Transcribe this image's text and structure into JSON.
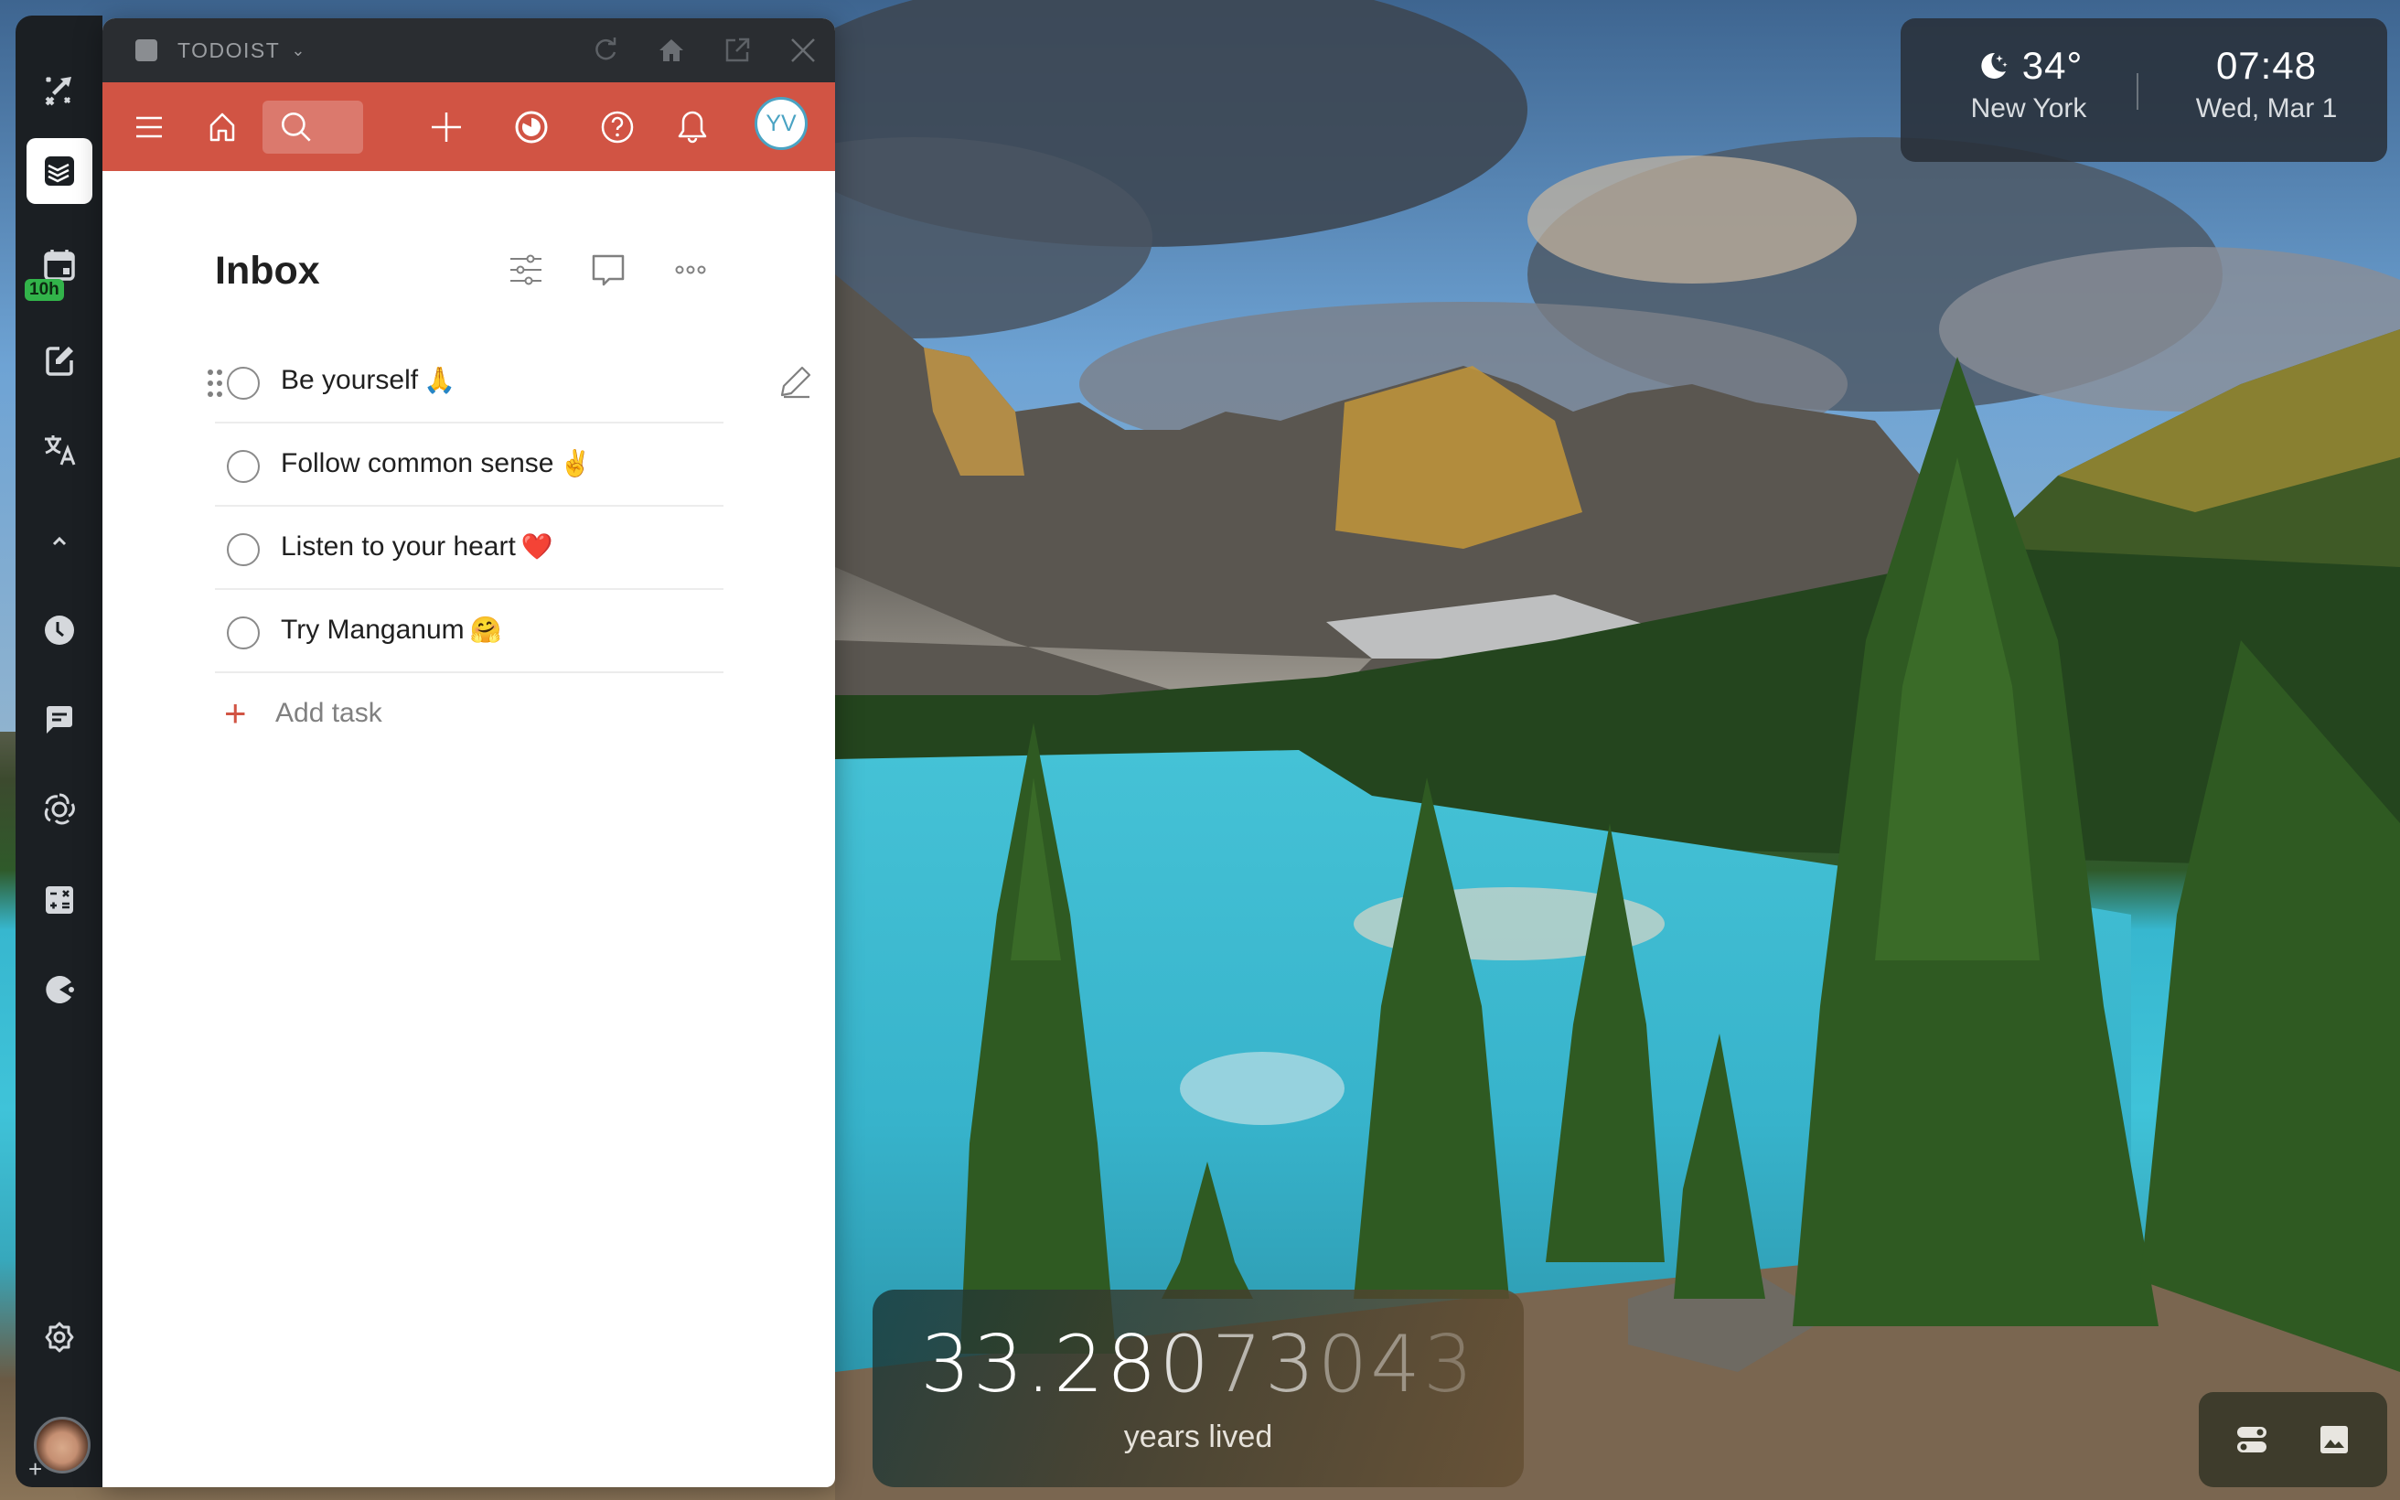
{
  "window": {
    "app_name": "TODOIST",
    "titlebar_actions": [
      "reload",
      "home",
      "open-external",
      "close"
    ]
  },
  "dock": {
    "items": [
      {
        "name": "manganum-logo",
        "icon": "sparkle-arrow-icon"
      },
      {
        "name": "todoist",
        "icon": "todoist-icon",
        "active": true
      },
      {
        "name": "calendar",
        "icon": "calendar-icon",
        "badge": "10h"
      },
      {
        "name": "notes",
        "icon": "edit-note-icon"
      },
      {
        "name": "translate",
        "icon": "translate-icon"
      },
      {
        "name": "collapse",
        "icon": "chevron-up-icon"
      },
      {
        "name": "clock",
        "icon": "clock-icon"
      },
      {
        "name": "chat",
        "icon": "chat-icon"
      },
      {
        "name": "chatgpt",
        "icon": "openai-icon"
      },
      {
        "name": "calculator",
        "icon": "calculator-icon"
      },
      {
        "name": "game",
        "icon": "pacman-icon"
      },
      {
        "name": "settings",
        "icon": "gear-icon"
      }
    ]
  },
  "appbar": {
    "search_placeholder": "",
    "user_initials": "YV",
    "accent_color": "#d15444"
  },
  "inbox": {
    "title": "Inbox",
    "tasks": [
      {
        "text": "Be yourself",
        "emoji": "🙏"
      },
      {
        "text": "Follow common sense",
        "emoji": "✌️"
      },
      {
        "text": "Listen to your heart",
        "emoji": "❤️"
      },
      {
        "text": "Try Manganum",
        "emoji": "🤗"
      }
    ],
    "add_task_label": "Add task"
  },
  "weather": {
    "temperature": "34°",
    "condition_icon": "moon-stars-icon",
    "city": "New York",
    "time": "07:48",
    "date": "Wed, Mar 1"
  },
  "years_lived": {
    "value_bright": "33.28",
    "value_fade1": "0",
    "value_fade2": "73",
    "value_fade3": "04",
    "value_fade4": "3",
    "caption": "years lived"
  },
  "quick_actions": [
    "toggles-icon",
    "image-icon"
  ]
}
